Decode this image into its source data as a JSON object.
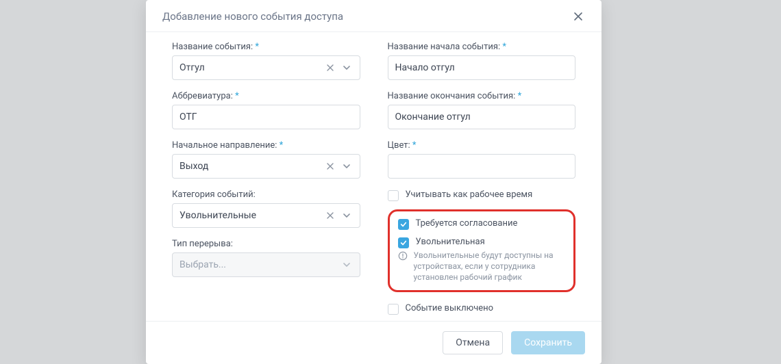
{
  "modal": {
    "title": "Добавление нового события доступа",
    "close": "×"
  },
  "left": {
    "event_name_label": "Название события:",
    "event_name_value": "Отгул",
    "abbrev_label": "Аббревиатура:",
    "abbrev_value": "ОТГ",
    "direction_label": "Начальное направление:",
    "direction_value": "Выход",
    "category_label": "Категория событий:",
    "category_value": "Увольнительные",
    "break_type_label": "Тип перерыва:",
    "break_type_placeholder": "Выбрать..."
  },
  "right": {
    "start_name_label": "Название начала события:",
    "start_name_value": "Начало отгул",
    "end_name_label": "Название окончания события:",
    "end_name_value": "Окончание отгул",
    "color_label": "Цвет:",
    "color_value": "",
    "cb_worktime": "Учитывать как рабочее время",
    "cb_approval": "Требуется согласование",
    "cb_leave": "Увольнительная",
    "hint": "Увольнительные будут доступны на устройствах, если у сотрудника установлен рабочий график",
    "cb_disabled": "Событие выключено"
  },
  "footer": {
    "cancel": "Отмена",
    "save": "Сохранить"
  },
  "required_mark": "*"
}
